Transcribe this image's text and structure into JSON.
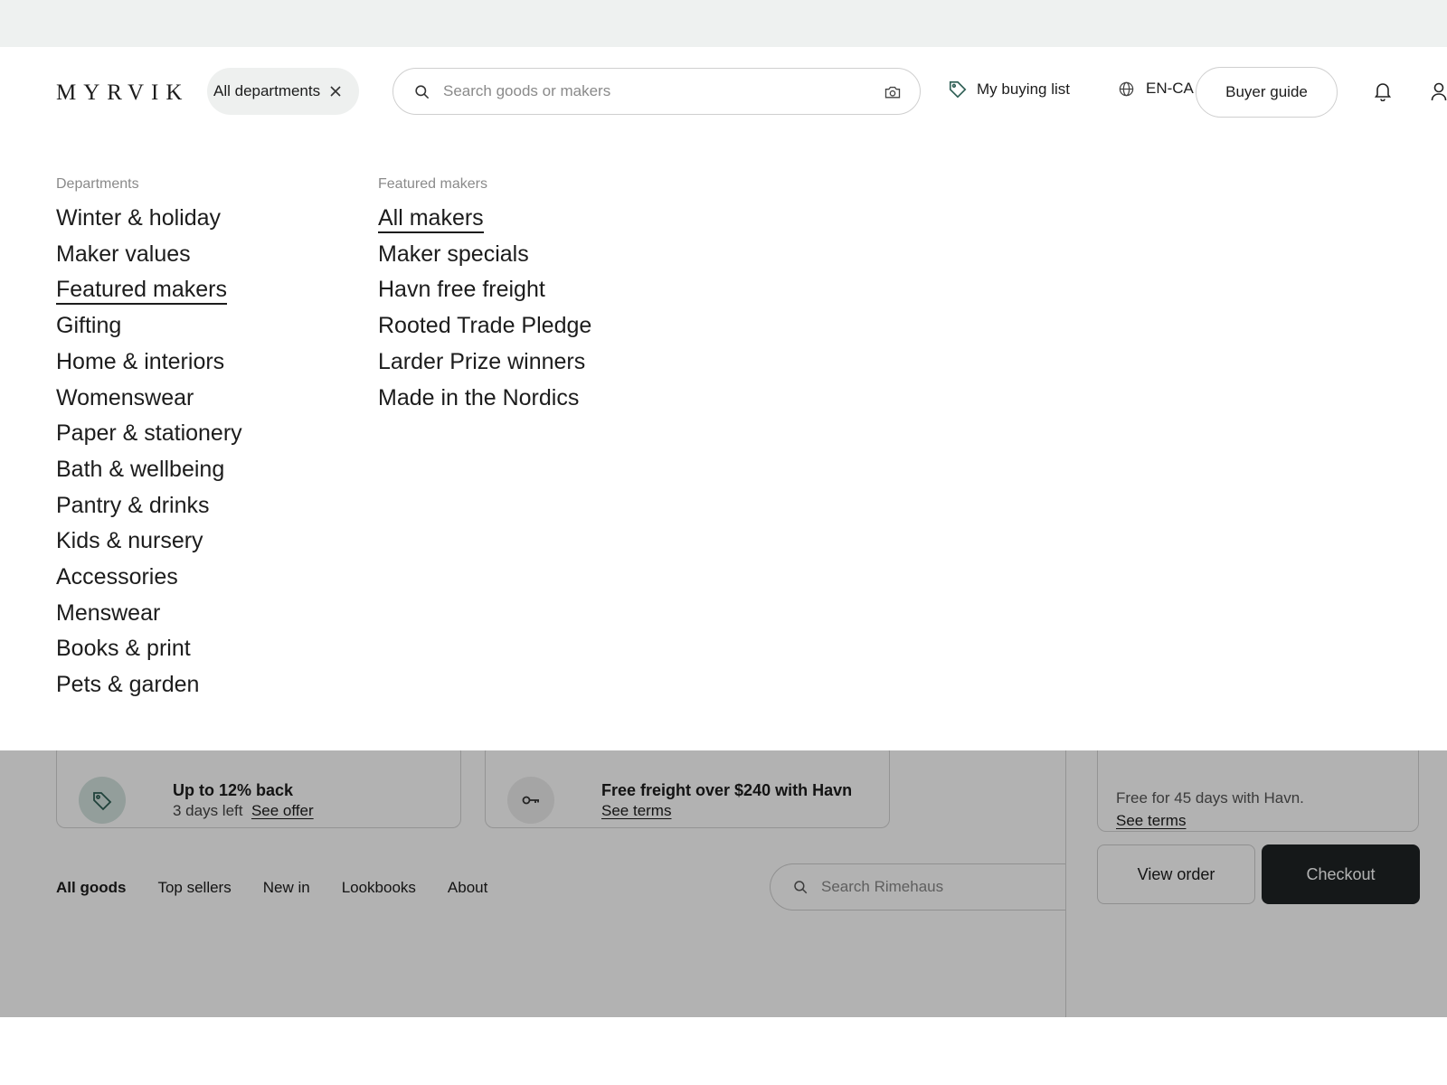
{
  "header": {
    "logo": "MYRVIK",
    "department_filter": "All departments",
    "search_placeholder": "Search goods or makers",
    "buying_list": "My buying list",
    "locale": "EN-CA",
    "buyer_guide": "Buyer guide"
  },
  "mega_menu": {
    "departments": {
      "heading": "Departments",
      "items": [
        "Winter & holiday",
        "Maker values",
        "Featured makers",
        "Gifting",
        "Home & interiors",
        "Womenswear",
        "Paper & stationery",
        "Bath & wellbeing",
        "Pantry & drinks",
        "Kids & nursery",
        "Accessories",
        "Menswear",
        "Books & print",
        "Pets & garden"
      ],
      "selected_index": 2
    },
    "featured_makers": {
      "heading": "Featured makers",
      "items": [
        "All makers",
        "Maker specials",
        "Havn free freight",
        "Rooted Trade Pledge",
        "Larder Prize winners",
        "Made in the Nordics"
      ],
      "selected_index": 0
    }
  },
  "promos": [
    {
      "title": "Up to 12% back",
      "subtitle": "3 days left",
      "link": "See offer",
      "icon": "tag-icon"
    },
    {
      "title": "Free freight over $240 with Havn",
      "subtitle": "",
      "link": "See terms",
      "icon": "key-icon"
    }
  ],
  "order_panel": {
    "offer_text": "Free for 45 days with Havn.",
    "offer_link": "See terms",
    "view_order": "View order",
    "checkout": "Checkout"
  },
  "store_nav": {
    "items": [
      "All goods",
      "Top sellers",
      "New in",
      "Lookbooks",
      "About"
    ],
    "active_index": 0,
    "search_placeholder": "Search Rimehaus"
  },
  "colors": {
    "checkout_bg": "#1f2325",
    "promo_icon_bg": "#d3e3de",
    "tag_icon": "#2f5f55"
  }
}
